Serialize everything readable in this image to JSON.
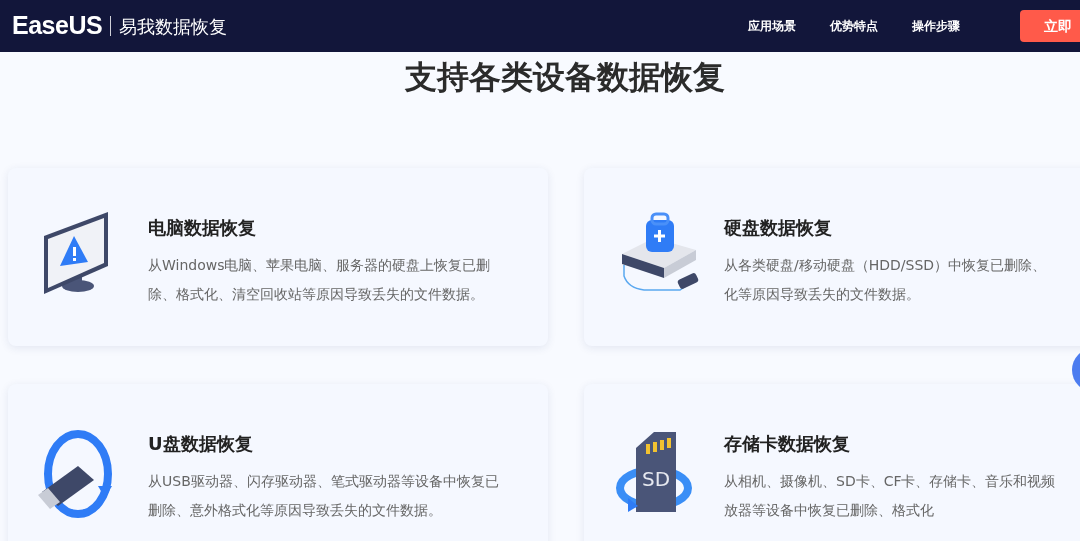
{
  "header": {
    "logo": "EaseUS",
    "product": "易我数据恢复",
    "nav": [
      "应用场景",
      "优势特点",
      "操作步骤"
    ],
    "cta": "立即"
  },
  "title": "支持各类设备数据恢复",
  "cards": [
    {
      "kind": "monitor",
      "title": "电脑数据恢复",
      "lines": [
        "从Windows电脑、苹果电脑、服务器的硬盘上恢复已删",
        "除、格式化、清空回收站等原因导致丢失的文件数据。"
      ]
    },
    {
      "kind": "drive",
      "title": "硬盘数据恢复",
      "lines": [
        "从各类硬盘/移动硬盘（HDD/SSD）中恢复已删除、",
        "化等原因导致丢失的文件数据。"
      ]
    },
    {
      "kind": "usb",
      "title": "U盘数据恢复",
      "lines": [
        "从USB驱动器、闪存驱动器、笔式驱动器等设备中恢复已",
        "删除、意外格式化等原因导致丢失的文件数据。"
      ]
    },
    {
      "kind": "sd",
      "icon_text": "SD",
      "title": "存储卡数据恢复",
      "lines": [
        "从相机、摄像机、SD卡、CF卡、存储卡、音乐和视频",
        "放器等设备中恢复已删除、格式化"
      ]
    }
  ]
}
